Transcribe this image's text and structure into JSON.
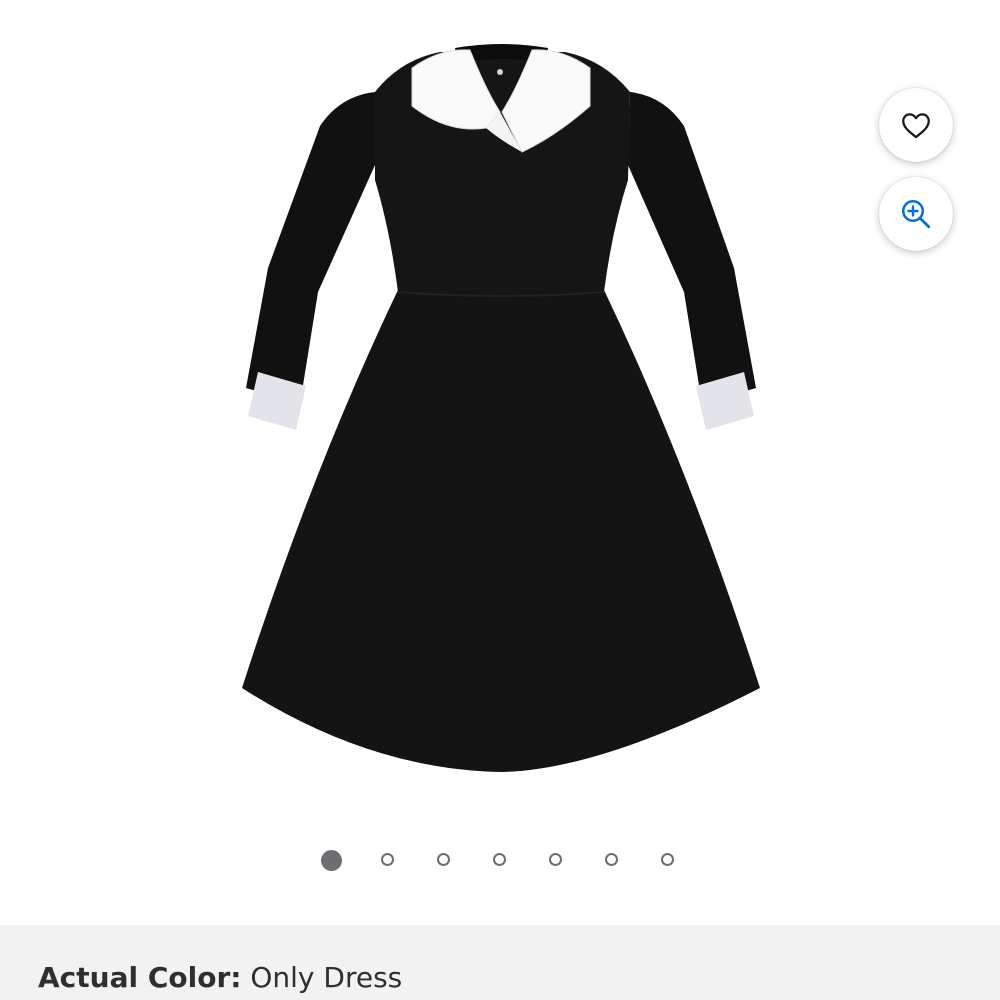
{
  "gallery": {
    "image_alt": "Black long-sleeve dress with white collar and cuffs",
    "favorite_icon": "heart-icon",
    "zoom_icon": "zoom-in-icon",
    "accent_color": "#0071dc",
    "dots": {
      "count": 7,
      "active_index": 0
    }
  },
  "variant": {
    "label": "Actual Color:",
    "value": "Only Dress"
  }
}
